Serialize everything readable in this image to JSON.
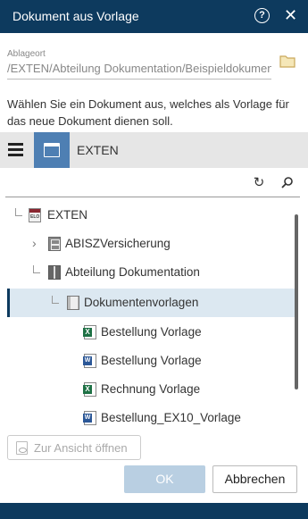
{
  "dialog": {
    "title": "Dokument aus Vorlage",
    "help_icon": "question-circle-icon",
    "close_icon": "close-icon"
  },
  "location": {
    "label": "Ablageort",
    "value": "/EXTEN/Abteilung Dokumentation/Beispieldokumente",
    "folder_icon": "folder-icon"
  },
  "description": "Wählen Sie ein Dokument aus, welches als Vorlage für das neue Dokument dienen soll.",
  "toolbar": {
    "menu_icon": "hamburger-menu-icon",
    "workspace_icon": "window-icon",
    "workspace_label": "EXTEN"
  },
  "tree_tools": {
    "refresh_icon": "refresh-icon",
    "search_icon": "search-icon"
  },
  "tree": [
    {
      "label": "EXTEN",
      "icon": "archive-icon"
    },
    {
      "label": "ABISZVersicherung",
      "icon": "cabinet-icon"
    },
    {
      "label": "Abteilung Dokumentation",
      "icon": "binder-icon"
    },
    {
      "label": "Dokumentenvorlagen",
      "icon": "folder-icon",
      "selected": true
    },
    {
      "label": "Bestellung Vorlage",
      "icon": "excel-file-icon"
    },
    {
      "label": "Bestellung Vorlage",
      "icon": "word-file-icon"
    },
    {
      "label": "Rechnung Vorlage",
      "icon": "excel-file-icon"
    },
    {
      "label": "Bestellung_EX10_Vorlage",
      "icon": "word-file-icon"
    }
  ],
  "buttons": {
    "view": "Zur Ansicht öffnen",
    "ok": "OK",
    "cancel": "Abbrechen"
  },
  "colors": {
    "titlebar": "#0d3a5e",
    "accent": "#4e7fb3",
    "selection": "#dce8f1"
  }
}
